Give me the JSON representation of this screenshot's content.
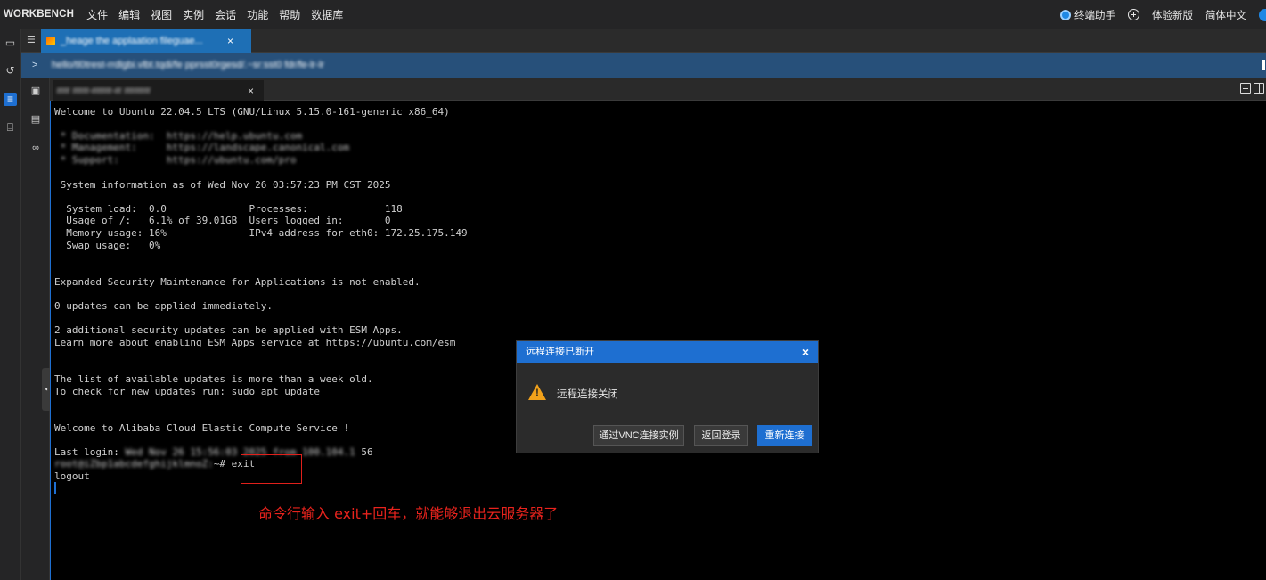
{
  "menubar": {
    "brand": "WORKBENCH",
    "items": [
      "文件",
      "编辑",
      "视图",
      "实例",
      "会话",
      "功能",
      "帮助",
      "数据库"
    ],
    "right": {
      "assistant": "终端助手",
      "new_version": "体验新版",
      "language": "简体中文"
    }
  },
  "tabs": {
    "main_tab": "_heage the applaation fileguae...",
    "close": "×"
  },
  "address": {
    "arrow": ">",
    "text": "hello/tl0trest-rrdlgbi.vlbt.tqdi/fe pprsst0rgesd/.~sr:sst0 fdr/fe-lr-lr"
  },
  "terminal_tab": {
    "title": "rrrr rrrrr-rrrrrr-rr rrrrrrrr",
    "close": "×"
  },
  "terminal": {
    "lines": [
      {
        "text": "Welcome to Ubuntu 22.04.5 LTS (GNU/Linux 5.15.0-161-generic x86_64)",
        "blur": false
      },
      {
        "text": "",
        "blur": false
      },
      {
        "text": " * Documentation:  https://help.ubuntu.com",
        "blur": true
      },
      {
        "text": " * Management:     https://landscape.canonical.com",
        "blur": true
      },
      {
        "text": " * Support:        https://ubuntu.com/pro",
        "blur": true
      },
      {
        "text": "",
        "blur": false
      },
      {
        "text": " System information as of Wed Nov 26 03:57:23 PM CST 2025",
        "blur": false
      },
      {
        "text": "",
        "blur": false
      },
      {
        "text": "  System load:  0.0              Processes:             118",
        "blur": false
      },
      {
        "text": "  Usage of /:   6.1% of 39.01GB  Users logged in:       0",
        "blur": false
      },
      {
        "text": "  Memory usage: 16%              IPv4 address for eth0: 172.25.175.149",
        "blur": false
      },
      {
        "text": "  Swap usage:   0%",
        "blur": false
      },
      {
        "text": "",
        "blur": false
      },
      {
        "text": "",
        "blur": false
      },
      {
        "text": "Expanded Security Maintenance for Applications is not enabled.",
        "blur": false
      },
      {
        "text": "",
        "blur": false
      },
      {
        "text": "0 updates can be applied immediately.",
        "blur": false
      },
      {
        "text": "",
        "blur": false
      },
      {
        "text": "2 additional security updates can be applied with ESM Apps.",
        "blur": false
      },
      {
        "text": "Learn more about enabling ESM Apps service at https://ubuntu.com/esm",
        "blur": false
      },
      {
        "text": "",
        "blur": false
      },
      {
        "text": "",
        "blur": false
      },
      {
        "text": "The list of available updates is more than a week old.",
        "blur": false
      },
      {
        "text": "To check for new updates run: sudo apt update",
        "blur": false
      },
      {
        "text": "",
        "blur": false
      },
      {
        "text": "",
        "blur": false
      },
      {
        "text": "Welcome to Alibaba Cloud Elastic Compute Service !",
        "blur": false
      },
      {
        "text": "",
        "blur": false
      }
    ],
    "last_login_label": "Last login: ",
    "last_login_masked": "Wed Nov 26 15:56:03 2025 from 100.104.1",
    "last_login_tail": "56",
    "prompt_masked": "root@iZbp1abcdefghijklmnoZ:",
    "prompt_tail": "~# exit",
    "logout": "logout"
  },
  "annotation": "命令行输入 exit+回车，就能够退出云服务器了",
  "dialog": {
    "title": "远程连接已断开",
    "close": "×",
    "message": "远程连接关闭",
    "warn_mark": "!",
    "buttons": {
      "vnc": "通过VNC连接实例",
      "back": "返回登录",
      "reconnect": "重新连接"
    }
  },
  "icons": {
    "accent": "#1e6fd1",
    "annotation_color": "#e8231d",
    "warning_color": "#f2a21b"
  }
}
